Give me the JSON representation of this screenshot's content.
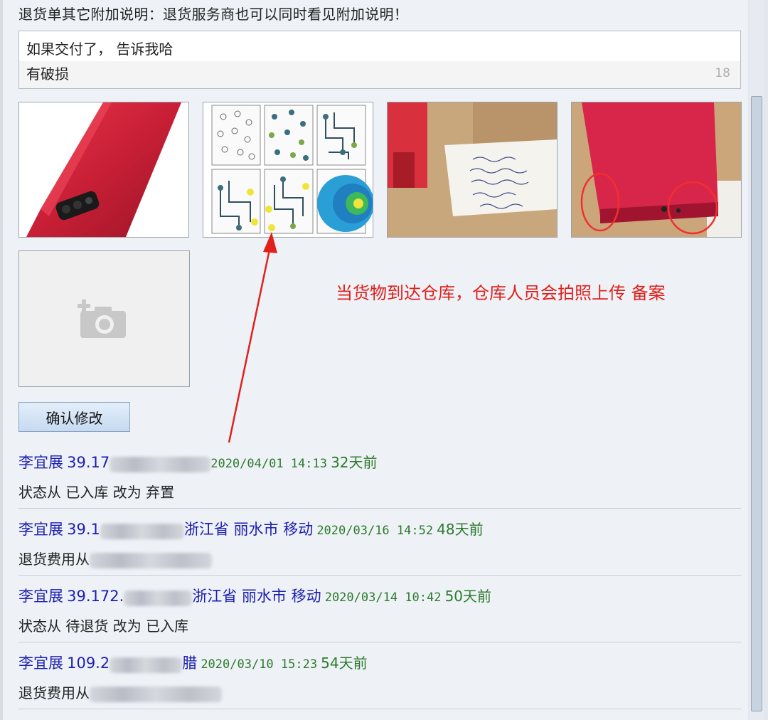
{
  "header": {
    "title": "退货单其它附加说明：退货服务商也可以同时看见附加说明！"
  },
  "note": {
    "line1": "如果交付了，  告诉我哈",
    "line2": "有破损",
    "char_count": "18"
  },
  "photos": [
    {
      "name": "red-phone-case-back"
    },
    {
      "name": "dot-grid-diagram"
    },
    {
      "name": "package-label-photo"
    },
    {
      "name": "damaged-case-photo"
    }
  ],
  "annotation": {
    "text": "当货物到达仓库，仓库人员会拍照上传 备案"
  },
  "confirm_button": {
    "label": "确认修改"
  },
  "logs": [
    {
      "user": "李宜展",
      "ip": "39.17",
      "location": "",
      "time": "2020/04/01  14:13",
      "ago": "32天前",
      "body": "状态从 已入库 改为 弃置"
    },
    {
      "user": "李宜展",
      "ip": "39.1",
      "location": "浙江省 丽水市 移动",
      "time": "2020/03/16  14:52",
      "ago": "48天前",
      "body": "退货费用从"
    },
    {
      "user": "李宜展",
      "ip": "39.172.",
      "location": "浙江省 丽水市 移动",
      "time": "2020/03/14  10:42",
      "ago": "50天前",
      "body": "状态从 待退货 改为 已入库"
    },
    {
      "user": "李宜展",
      "ip": "109.2",
      "location": "腊",
      "time": "2020/03/10  15:23",
      "ago": "54天前",
      "body": "退货费用从"
    }
  ],
  "colors": {
    "annotation": "#e0201b",
    "user_link": "#1b1eb0",
    "timestamp": "#2c7a2c"
  },
  "icons": {
    "upload": "camera-plus-icon"
  }
}
